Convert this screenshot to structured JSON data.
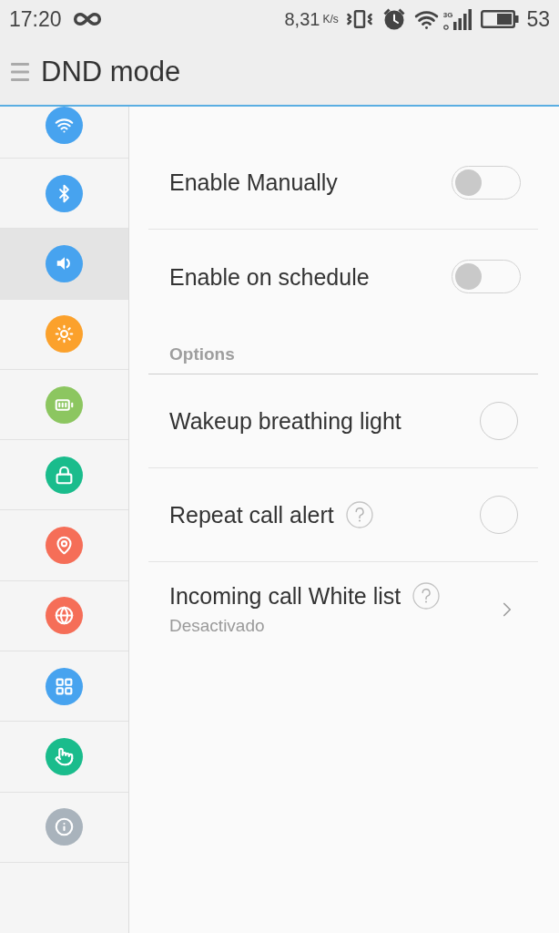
{
  "status_bar": {
    "time": "17:20",
    "speed": "8,31",
    "speed_unit": "K/s",
    "network_type": "3G",
    "battery": "53"
  },
  "toolbar": {
    "title": "DND mode"
  },
  "sidebar": {
    "items": [
      {
        "kind": "wifi",
        "color": "#47a3ef",
        "selected": false
      },
      {
        "kind": "bluetooth",
        "color": "#47a3ef",
        "selected": false
      },
      {
        "kind": "sound",
        "color": "#47a3ef",
        "selected": true
      },
      {
        "kind": "brightness",
        "color": "#fba12c",
        "selected": false
      },
      {
        "kind": "battery",
        "color": "#8cc660",
        "selected": false
      },
      {
        "kind": "lock",
        "color": "#1abc8c",
        "selected": false
      },
      {
        "kind": "location",
        "color": "#f56e58",
        "selected": false
      },
      {
        "kind": "globe",
        "color": "#f56e58",
        "selected": false
      },
      {
        "kind": "apps",
        "color": "#47a3ef",
        "selected": false
      },
      {
        "kind": "touch",
        "color": "#1abc8c",
        "selected": false
      },
      {
        "kind": "info",
        "color": "#a9b3bc",
        "selected": false
      }
    ]
  },
  "settings": [
    {
      "kind": "toggle",
      "label": "Enable Manually",
      "on": false
    },
    {
      "kind": "toggle",
      "label": "Enable on schedule",
      "on": false
    },
    {
      "kind": "header",
      "label": "Options"
    },
    {
      "kind": "radio",
      "label": "Wakeup breathing light",
      "checked": false
    },
    {
      "kind": "radio",
      "label": "Repeat call alert",
      "help": true,
      "checked": false
    },
    {
      "kind": "link",
      "label": "Incoming call White list",
      "help": true,
      "subtitle": "Desactivado"
    }
  ]
}
